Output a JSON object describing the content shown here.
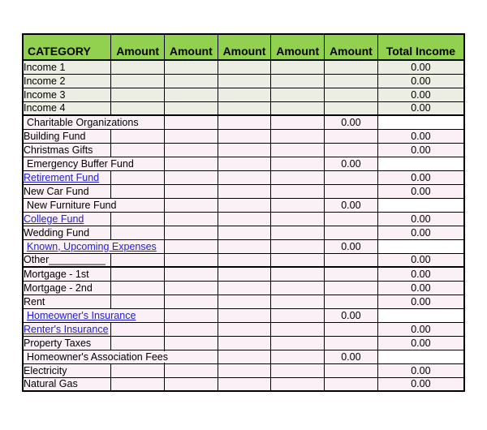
{
  "table": {
    "headers": {
      "category": "CATEGORY",
      "amount": "Amount",
      "total": "Total Income"
    },
    "amount_column_count": 5,
    "colors": {
      "header_green": "#92D050",
      "income_row": "#ECEDE3",
      "expense_row": "#FAF0F5",
      "link_blue": "#2222CC",
      "grid_line": "#000000"
    },
    "rows": [
      {
        "label": "Income 1",
        "total": "0.00",
        "tint": "income",
        "link": false,
        "overflow": false,
        "section_end": false,
        "amount_cells": 5
      },
      {
        "label": "Income 2",
        "total": "0.00",
        "tint": "income",
        "link": false,
        "overflow": false,
        "section_end": false,
        "amount_cells": 5
      },
      {
        "label": "Income 3",
        "total": "0.00",
        "tint": "income",
        "link": false,
        "overflow": false,
        "section_end": false,
        "amount_cells": 5
      },
      {
        "label": "Income 4",
        "total": "0.00",
        "tint": "income",
        "link": false,
        "overflow": false,
        "section_end": true,
        "amount_cells": 5
      },
      {
        "label": "Charitable Organizations",
        "total": "0.00",
        "tint": "expense",
        "link": false,
        "overflow": true,
        "section_end": false,
        "amount_cells": 5
      },
      {
        "label": "Building Fund",
        "total": "0.00",
        "tint": "expense",
        "link": false,
        "overflow": false,
        "section_end": false,
        "amount_cells": 5
      },
      {
        "label": "Christmas Gifts",
        "total": "0.00",
        "tint": "expense",
        "link": false,
        "overflow": false,
        "section_end": false,
        "amount_cells": 5
      },
      {
        "label": "Emergency Buffer Fund",
        "total": "0.00",
        "tint": "expense",
        "link": false,
        "overflow": true,
        "section_end": false,
        "amount_cells": 5
      },
      {
        "label": "Retirement Fund",
        "total": "0.00",
        "tint": "expense",
        "link": true,
        "overflow": false,
        "section_end": false,
        "amount_cells": 5
      },
      {
        "label": "New Car Fund",
        "total": "0.00",
        "tint": "expense",
        "link": false,
        "overflow": false,
        "section_end": false,
        "amount_cells": 5
      },
      {
        "label": "New Furniture Fund",
        "total": "0.00",
        "tint": "expense",
        "link": false,
        "overflow": true,
        "section_end": false,
        "amount_cells": 5
      },
      {
        "label": "College Fund",
        "total": "0.00",
        "tint": "expense",
        "link": true,
        "overflow": false,
        "section_end": false,
        "amount_cells": 5
      },
      {
        "label": "Wedding Fund",
        "total": "0.00",
        "tint": "expense",
        "link": false,
        "overflow": false,
        "section_end": false,
        "amount_cells": 5
      },
      {
        "label": "Known, Upcoming Expenses",
        "total": "0.00",
        "tint": "expense",
        "link": true,
        "overflow": true,
        "section_end": false,
        "amount_cells": 5
      },
      {
        "label": "Other__________",
        "total": "0.00",
        "tint": "expense",
        "link": false,
        "overflow": false,
        "section_end": true,
        "amount_cells": 5
      },
      {
        "label": "Mortgage - 1st",
        "total": "0.00",
        "tint": "expense",
        "link": false,
        "overflow": false,
        "section_end": false,
        "amount_cells": 5
      },
      {
        "label": "Mortgage - 2nd",
        "total": "0.00",
        "tint": "expense",
        "link": false,
        "overflow": false,
        "section_end": false,
        "amount_cells": 5
      },
      {
        "label": "Rent",
        "total": "0.00",
        "tint": "expense",
        "link": false,
        "overflow": false,
        "section_end": false,
        "amount_cells": 5
      },
      {
        "label": "Homeowner's Insurance",
        "total": "0.00",
        "tint": "expense",
        "link": true,
        "overflow": true,
        "section_end": false,
        "amount_cells": 5
      },
      {
        "label": "Renter's Insurance",
        "total": "0.00",
        "tint": "expense",
        "link": true,
        "overflow": false,
        "section_end": false,
        "amount_cells": 5
      },
      {
        "label": "Property Taxes",
        "total": "0.00",
        "tint": "expense",
        "link": false,
        "overflow": false,
        "section_end": false,
        "amount_cells": 5
      },
      {
        "label": "Homeowner's Association Fees",
        "total": "0.00",
        "tint": "expense",
        "link": false,
        "overflow": true,
        "section_end": false,
        "amount_cells": 5
      },
      {
        "label": "Electricity",
        "total": "0.00",
        "tint": "expense",
        "link": false,
        "overflow": false,
        "section_end": false,
        "amount_cells": 5
      },
      {
        "label": "Natural Gas",
        "total": "0.00",
        "tint": "expense",
        "link": false,
        "overflow": false,
        "section_end": false,
        "amount_cells": 5
      }
    ]
  }
}
